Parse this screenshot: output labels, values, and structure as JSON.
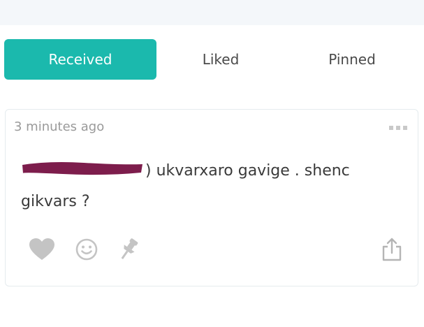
{
  "tabs": {
    "received_label": "Received",
    "liked_label": "Liked",
    "pinned_label": "Pinned",
    "active": "Received"
  },
  "card": {
    "timestamp": "3 minutes ago",
    "message_visible_text": ") ukvarxaro gavige . shenc gikvars ?",
    "message_redacted": true,
    "icons": {
      "more": "more-options-icon",
      "like": "heart-icon",
      "react": "smiley-icon",
      "pin": "pin-icon",
      "share": "share-icon"
    }
  },
  "colors": {
    "accent": "#1bb9ad",
    "icon_gray": "#c4c4c4",
    "redaction": "#7d1d4c"
  }
}
